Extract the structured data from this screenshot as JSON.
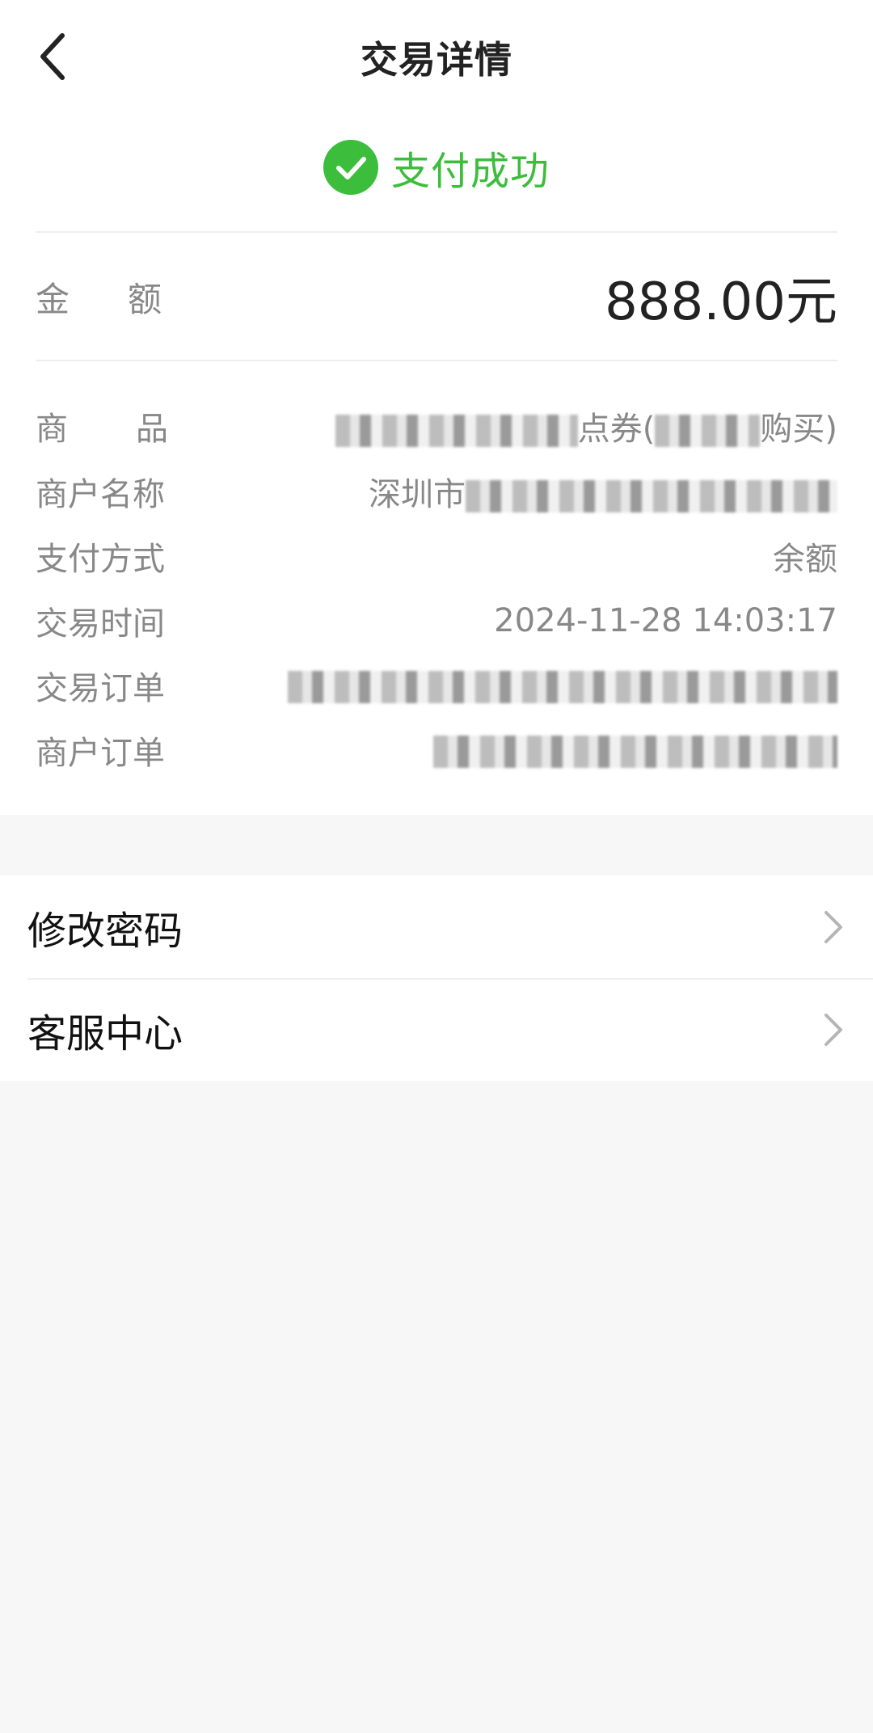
{
  "header": {
    "title": "交易详情",
    "back_icon": "back-arrow-icon"
  },
  "status": {
    "icon": "check-circle-icon",
    "text": "支付成功",
    "color": "#3cbd3c"
  },
  "amount": {
    "label": "金额",
    "value": "888.00元"
  },
  "details": {
    "product": {
      "label": "商品",
      "value_visible": "点券(",
      "value_tail": "购买)"
    },
    "merchant_name": {
      "label": "商户名称",
      "value_visible": "深圳市"
    },
    "payment_method": {
      "label": "支付方式",
      "value": "余额"
    },
    "transaction_time": {
      "label": "交易时间",
      "value": "2024-11-28 14:03:17"
    },
    "transaction_order": {
      "label": "交易订单"
    },
    "merchant_order": {
      "label": "商户订单"
    }
  },
  "menu": [
    {
      "label": "修改密码",
      "icon": "chevron-right-icon"
    },
    {
      "label": "客服中心",
      "icon": "chevron-right-icon"
    }
  ]
}
